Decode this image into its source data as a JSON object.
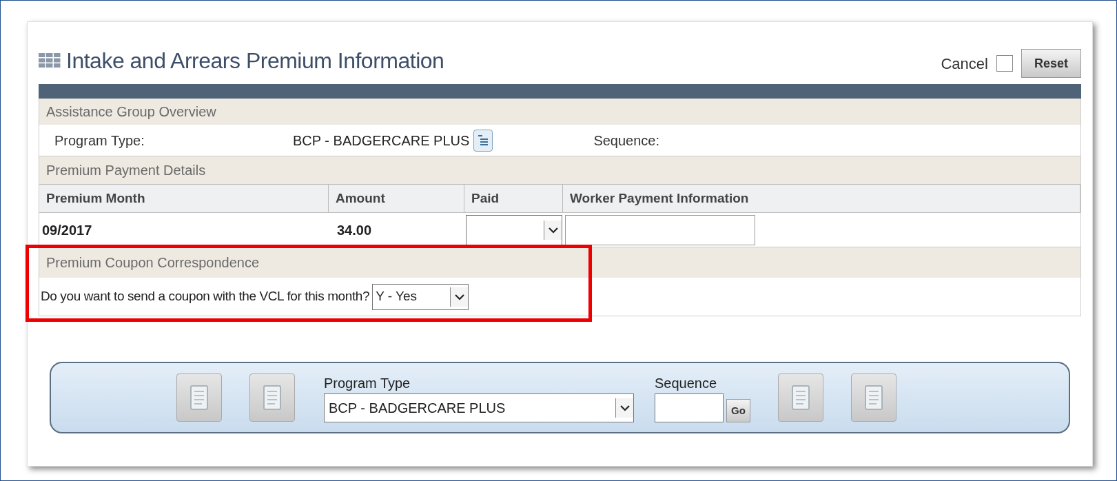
{
  "page": {
    "title": "Intake and Arrears Premium Information",
    "cancel": {
      "label": "Cancel",
      "checked": false
    },
    "reset_button": "Reset"
  },
  "overview": {
    "header": "Assistance Group Overview",
    "program_type_label": "Program Type:",
    "program_type_value": "BCP  - BADGERCARE PLUS",
    "sequence_label": "Sequence:"
  },
  "payment_details": {
    "header": "Premium Payment Details",
    "columns": [
      "Premium Month",
      "Amount",
      "Paid",
      "Worker Payment Information"
    ],
    "rows": [
      {
        "premium_month": "09/2017",
        "amount": "34.00"
      }
    ]
  },
  "coupon": {
    "header": "Premium Coupon Correspondence",
    "question": "Do you want to send a coupon with the VCL for this month?",
    "answer": "Y - Yes",
    "highlighted": true
  },
  "navigation": {
    "program_type_label": "Program Type",
    "program_type_value": "BCP - BADGERCARE PLUS",
    "sequence_label": "Sequence",
    "go_button": "Go"
  }
}
